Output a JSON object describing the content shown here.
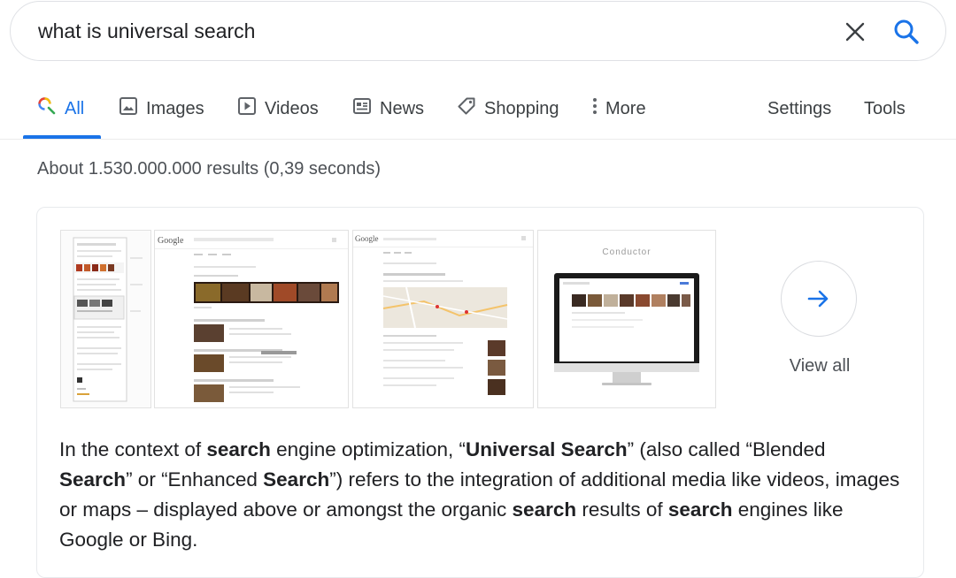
{
  "search": {
    "query": "what is universal search"
  },
  "tabs": [
    {
      "label": "All",
      "icon": "search-icon",
      "active": true
    },
    {
      "label": "Images",
      "icon": "image-icon"
    },
    {
      "label": "Videos",
      "icon": "video-icon"
    },
    {
      "label": "News",
      "icon": "news-icon"
    },
    {
      "label": "Shopping",
      "icon": "tag-icon"
    },
    {
      "label": "More",
      "icon": "more-vert-icon"
    }
  ],
  "tools": {
    "settings_label": "Settings",
    "tools_label": "Tools"
  },
  "result_stats": "About 1.530.000.000 results (0,39 seconds)",
  "card": {
    "thumbnails": [
      {
        "icon": "screenshot-thumbnail"
      },
      {
        "icon": "screenshot-thumbnail",
        "logo_text": "Google"
      },
      {
        "icon": "screenshot-thumbnail",
        "logo_text": "Google"
      },
      {
        "icon": "monitor-thumbnail",
        "logo_text": "Conductor"
      }
    ],
    "view_all_label": "View all",
    "snippet": [
      {
        "text": "In the context of ",
        "bold": false
      },
      {
        "text": "search",
        "bold": true
      },
      {
        "text": " engine optimization, “",
        "bold": false
      },
      {
        "text": "Universal Search",
        "bold": true
      },
      {
        "text": "” (also called “Blended ",
        "bold": false
      },
      {
        "text": "Search",
        "bold": true
      },
      {
        "text": "” or “Enhanced ",
        "bold": false
      },
      {
        "text": "Search",
        "bold": true
      },
      {
        "text": "”) refers to the integration of additional media like videos, images or maps – displayed above or amongst the organic ",
        "bold": false
      },
      {
        "text": "search",
        "bold": true
      },
      {
        "text": " results of ",
        "bold": false
      },
      {
        "text": "search",
        "bold": true
      },
      {
        "text": " engines like Google or Bing.",
        "bold": false
      }
    ]
  },
  "colors": {
    "accent": "#1a73e8",
    "text": "#202124",
    "muted": "#4d5156"
  }
}
